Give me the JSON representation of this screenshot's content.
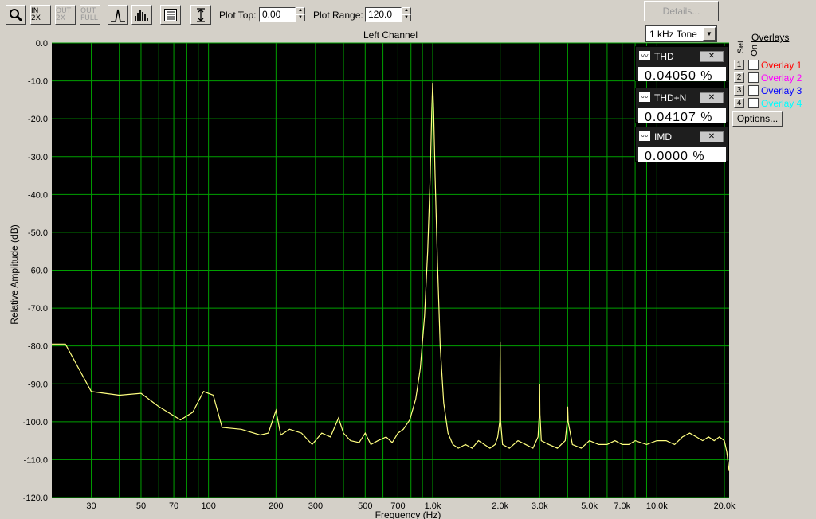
{
  "toolbar": {
    "plot_top_label": "Plot Top:",
    "plot_top_value": "0.00",
    "plot_range_label": "Plot Range:",
    "plot_range_value": "120.0",
    "details_label": "Details...",
    "tone_select": "1 kHz Tone",
    "zoom_in_label": "IN 2X",
    "zoom_out_label": "OUT 2X",
    "zoom_full_label": "OUT FULL"
  },
  "meters": [
    {
      "name": "THD",
      "value": "0.04050 %"
    },
    {
      "name": "THD+N",
      "value": "0.04107 %"
    },
    {
      "name": "IMD",
      "value": "0.0000 %"
    }
  ],
  "overlays": {
    "title": "Overlays",
    "set_label": "Set",
    "on_label": "On",
    "options_label": "Options...",
    "items": [
      {
        "num": "1",
        "name": "Overlay 1",
        "color": "#ff0000"
      },
      {
        "num": "2",
        "name": "Overlay 2",
        "color": "#ff00ff"
      },
      {
        "num": "3",
        "name": "Overlay 3",
        "color": "#0000ff"
      },
      {
        "num": "4",
        "name": "Overlay 4",
        "color": "#00ffff"
      }
    ]
  },
  "chart_data": {
    "type": "line",
    "title": "Left Channel",
    "xlabel": "Frequency (Hz)",
    "ylabel": "Relative Amplitude (dB)",
    "x_scale": "log",
    "xlim": [
      20,
      21000
    ],
    "ylim": [
      -120,
      0
    ],
    "grid": true,
    "background": "#000000",
    "grid_color": "#00a000",
    "line_color": "#ffff80",
    "y_ticks": [
      0,
      -10,
      -20,
      -30,
      -40,
      -50,
      -60,
      -70,
      -80,
      -90,
      -100,
      -110,
      -120
    ],
    "y_tick_labels": [
      "0.0",
      "-10.0",
      "-20.0",
      "-30.0",
      "-40.0",
      "-50.0",
      "-60.0",
      "-70.0",
      "-80.0",
      "-90.0",
      "-100.0",
      "-110.0",
      "-120.0"
    ],
    "x_ticks": [
      30,
      50,
      70,
      100,
      200,
      300,
      500,
      700,
      1000,
      2000,
      3000,
      5000,
      7000,
      10000,
      20000
    ],
    "x_tick_labels": [
      "30",
      "50",
      "70",
      "100",
      "200",
      "300",
      "500",
      "700",
      "1.0k",
      "2.0k",
      "3.0k",
      "5.0k",
      "7.0k",
      "10.0k",
      "20.0k"
    ],
    "series": [
      {
        "x": [
          20,
          23,
          30,
          40,
          50,
          60,
          75,
          85,
          95,
          105,
          115,
          140,
          170,
          185,
          200,
          210,
          230,
          260,
          290,
          320,
          350,
          380,
          400,
          430,
          470,
          500,
          530,
          570,
          620,
          660,
          700,
          740,
          790,
          840,
          880,
          920,
          950,
          975,
          990,
          1000,
          1010,
          1025,
          1050,
          1080,
          1120,
          1170,
          1230,
          1300,
          1400,
          1500,
          1600,
          1700,
          1800,
          1900,
          1950,
          1990,
          2000,
          2010,
          2050,
          2200,
          2400,
          2600,
          2800,
          2950,
          2990,
          3000,
          3010,
          3050,
          3300,
          3600,
          3900,
          3980,
          4000,
          4020,
          4200,
          4600,
          5000,
          5500,
          6000,
          6500,
          7000,
          7500,
          8000,
          9000,
          10000,
          11000,
          12000,
          13000,
          14000,
          15000,
          16000,
          17000,
          18000,
          19000,
          20000,
          20500,
          21000
        ],
        "y": [
          -79.5,
          -79.5,
          -92,
          -93,
          -92.5,
          -96,
          -99.5,
          -97.5,
          -92,
          -93,
          -101.5,
          -102,
          -103.5,
          -103,
          -97,
          -103.5,
          -102,
          -103,
          -106,
          -103,
          -104,
          -99,
          -103,
          -105,
          -105.5,
          -103,
          -106,
          -105,
          -104,
          -105.5,
          -103,
          -102,
          -99.5,
          -94,
          -86,
          -72,
          -55,
          -35,
          -18,
          -10.5,
          -18,
          -35,
          -58,
          -80,
          -95,
          -103,
          -106,
          -107,
          -106,
          -107,
          -105,
          -106,
          -107,
          -106,
          -104,
          -100,
          -79,
          -100,
          -106,
          -107,
          -105,
          -106,
          -107,
          -104,
          -98,
          -90,
          -98,
          -105,
          -106,
          -107,
          -105,
          -100,
          -96,
          -100,
          -106,
          -107,
          -105,
          -106,
          -106,
          -105,
          -106,
          -106,
          -105,
          -106,
          -105,
          -105,
          -106,
          -104,
          -103,
          -104,
          -105,
          -104,
          -105,
          -104,
          -105,
          -108,
          -113
        ]
      }
    ]
  }
}
